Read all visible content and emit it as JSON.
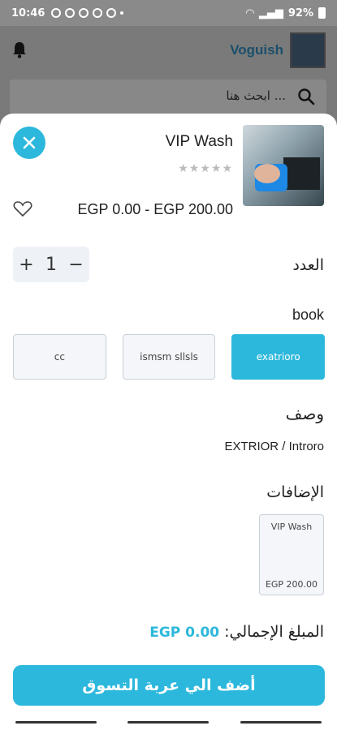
{
  "status_bar": {
    "time": "10:46",
    "battery": "92%"
  },
  "header": {
    "brand": "Voguish",
    "search_placeholder": "ابحث هنا ..."
  },
  "product": {
    "title": "VIP Wash",
    "stars": "★★★★★",
    "price_range": "EGP 0.00 - EGP 200.00"
  },
  "quantity": {
    "label": "العدد",
    "value": "1",
    "plus": "+",
    "minus": "−"
  },
  "book": {
    "label": "book",
    "options": [
      {
        "label": "exatrioro",
        "selected": true
      },
      {
        "label": "ismsm sllsls",
        "selected": false
      },
      {
        "label": "cc",
        "selected": false
      }
    ]
  },
  "description": {
    "label": "وصف",
    "text": "EXTRIOR / Introro"
  },
  "addons": {
    "label": "الإضافات",
    "items": [
      {
        "name": "VIP Wash",
        "price": "EGP 200.00"
      }
    ]
  },
  "total": {
    "label": "المبلغ الإجمالي:",
    "value": "EGP 0.00"
  },
  "add_to_cart": {
    "label": "أضف الي عربة التسوق"
  },
  "colors": {
    "accent": "#2cb8dc",
    "brand": "#1a4f6a"
  }
}
